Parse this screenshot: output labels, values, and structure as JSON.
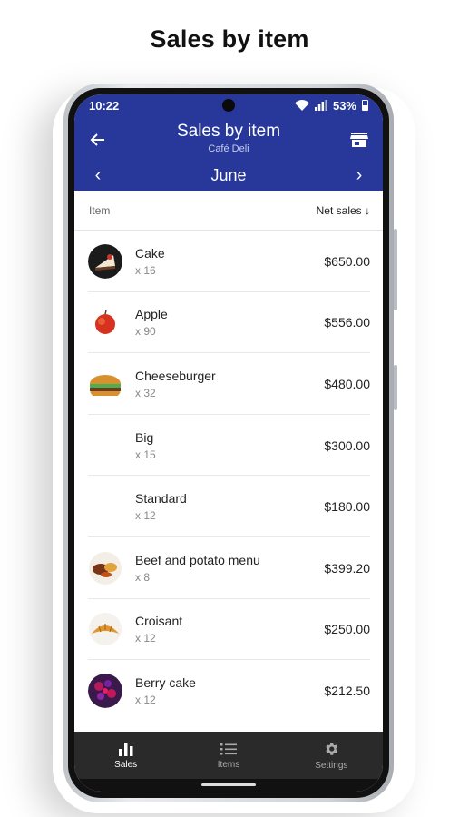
{
  "caption": "Sales by item",
  "status_bar": {
    "time": "10:22",
    "battery": "53%"
  },
  "app_bar": {
    "title": "Sales by item",
    "subtitle": "Café Deli",
    "back_icon": "arrow-left-icon",
    "store_icon": "storefront-icon"
  },
  "month_nav": {
    "prev": "‹",
    "label": "June",
    "next": "›"
  },
  "list_header": {
    "item": "Item",
    "net_sales": "Net sales ↓"
  },
  "items": [
    {
      "name": "Cake",
      "qty": "x 16",
      "sales": "$650.00",
      "icon": "cake"
    },
    {
      "name": "Apple",
      "qty": "x 90",
      "sales": "$556.00",
      "icon": "apple"
    },
    {
      "name": "Cheeseburger",
      "qty": "x 32",
      "sales": "$480.00",
      "icon": "burger"
    },
    {
      "name": "Big",
      "qty": "x 15",
      "sales": "$300.00",
      "icon": ""
    },
    {
      "name": "Standard",
      "qty": "x 12",
      "sales": "$180.00",
      "icon": ""
    },
    {
      "name": "Beef and potato menu",
      "qty": "x 8",
      "sales": "$399.20",
      "icon": "beef"
    },
    {
      "name": "Croisant",
      "qty": "x 12",
      "sales": "$250.00",
      "icon": "croissant"
    },
    {
      "name": "Berry cake",
      "qty": "x 12",
      "sales": "$212.50",
      "icon": "berry-cake"
    }
  ],
  "bottom_nav": [
    {
      "label": "Sales",
      "icon": "bar-chart-icon",
      "active": true
    },
    {
      "label": "Items",
      "icon": "list-icon",
      "active": false
    },
    {
      "label": "Settings",
      "icon": "gear-icon",
      "active": false
    }
  ],
  "colors": {
    "primary": "#27389a",
    "nav_bg": "#2a2a2a"
  }
}
